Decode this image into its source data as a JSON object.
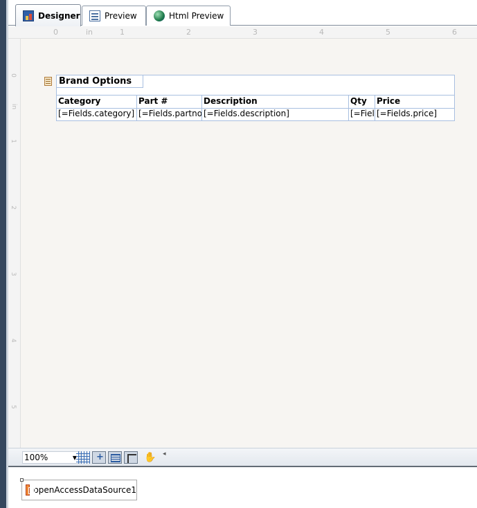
{
  "tabs": [
    {
      "label": "Designer",
      "icon": "designer-icon",
      "active": true
    },
    {
      "label": "Preview",
      "icon": "preview-icon",
      "active": false
    },
    {
      "label": "Html Preview",
      "icon": "globe-icon",
      "active": false
    }
  ],
  "ruler": {
    "horizontal": [
      "0",
      "in",
      "1",
      "2",
      "3",
      "4",
      "5",
      "6"
    ],
    "vertical": [
      "0",
      "in",
      "1",
      "2",
      "3",
      "4",
      "5"
    ]
  },
  "report": {
    "title": "Brand Options",
    "columns": [
      "Category",
      "Part #",
      "Description",
      "Qty",
      "Price"
    ],
    "row": [
      "[=Fields.category]",
      "[=Fields.partno]",
      "[=Fields.description]",
      "[=Fiel",
      "[=Fields.price]"
    ]
  },
  "toolbar": {
    "zoom": "100%",
    "zoom_arrow": "▼",
    "hand_glyph": "✋",
    "scroll_arrow": "◂"
  },
  "tray": {
    "component": "openAccessDataSource1"
  },
  "colors": {
    "surface": "#f7f5f2",
    "cell_border": "#a8bfe0",
    "left_bar": "#35475e"
  }
}
